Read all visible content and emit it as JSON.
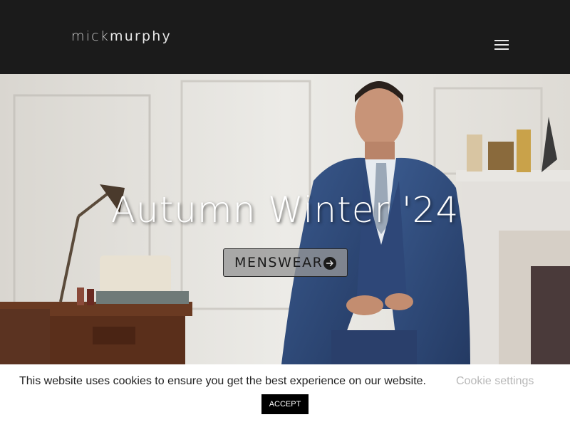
{
  "header": {
    "logo": {
      "first": "mick",
      "last": "murphy"
    },
    "menu_icon": "hamburger-menu-icon"
  },
  "hero": {
    "title": "Autumn Winter '24",
    "cta_label": "MENSWEAR",
    "cta_icon": "arrow-right-circle-icon"
  },
  "cookie_banner": {
    "message": "This website uses cookies to ensure you get the best experience on our website.",
    "settings_label": "Cookie settings",
    "accept_label": "ACCEPT"
  },
  "colors": {
    "header_bg": "#1b1b1b",
    "suit_blue": "#2f4a7a",
    "banner_bg": "#ffffff",
    "accept_bg": "#000000"
  }
}
